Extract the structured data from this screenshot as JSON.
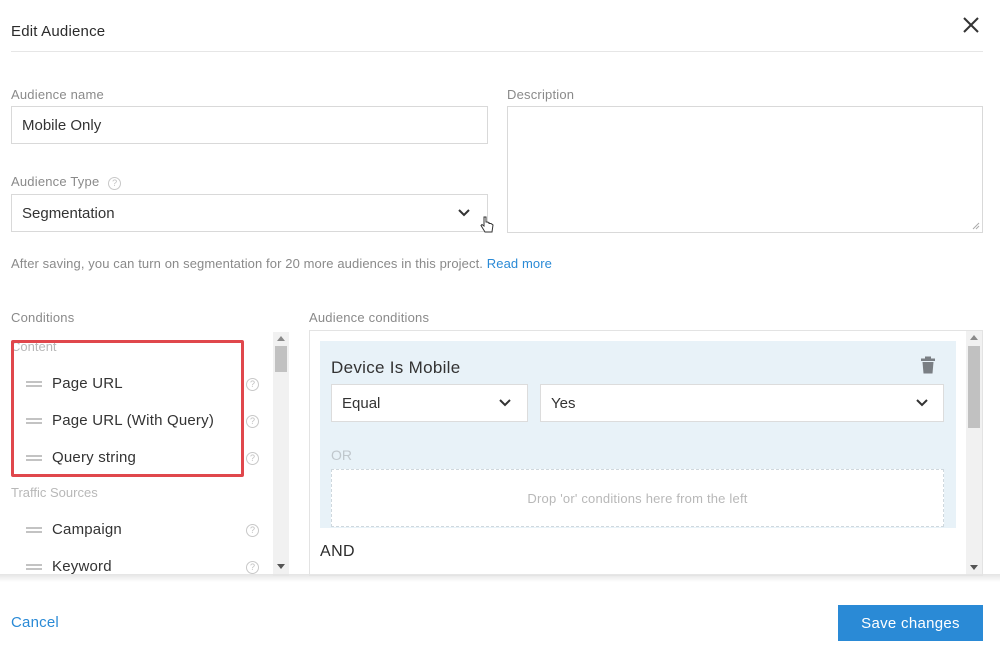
{
  "dialog": {
    "title": "Edit Audience"
  },
  "form": {
    "audience_name_label": "Audience name",
    "audience_name_value": "Mobile Only",
    "description_label": "Description",
    "description_value": "",
    "audience_type_label": "Audience Type",
    "audience_type_value": "Segmentation",
    "note_text": "After saving, you can turn on segmentation for 20 more audiences in this project.",
    "note_link": "Read more"
  },
  "conditions": {
    "label": "Conditions",
    "groups": [
      {
        "name": "Content",
        "items": [
          {
            "label": "Page URL"
          },
          {
            "label": "Page URL (With Query)"
          },
          {
            "label": "Query string"
          }
        ]
      },
      {
        "name": "Traffic Sources",
        "items": [
          {
            "label": "Campaign"
          },
          {
            "label": "Keyword"
          }
        ]
      }
    ]
  },
  "audience_conditions": {
    "label": "Audience conditions",
    "card": {
      "title": "Device Is Mobile",
      "operator": "Equal",
      "value": "Yes",
      "or_label": "OR",
      "dropzone_text": "Drop 'or' conditions here from the left"
    },
    "and_label": "AND"
  },
  "footer": {
    "cancel_label": "Cancel",
    "save_label": "Save changes"
  },
  "colors": {
    "accent": "#2a8ad6",
    "highlight": "#e0474c",
    "card_bg": "#e8f2f8"
  }
}
